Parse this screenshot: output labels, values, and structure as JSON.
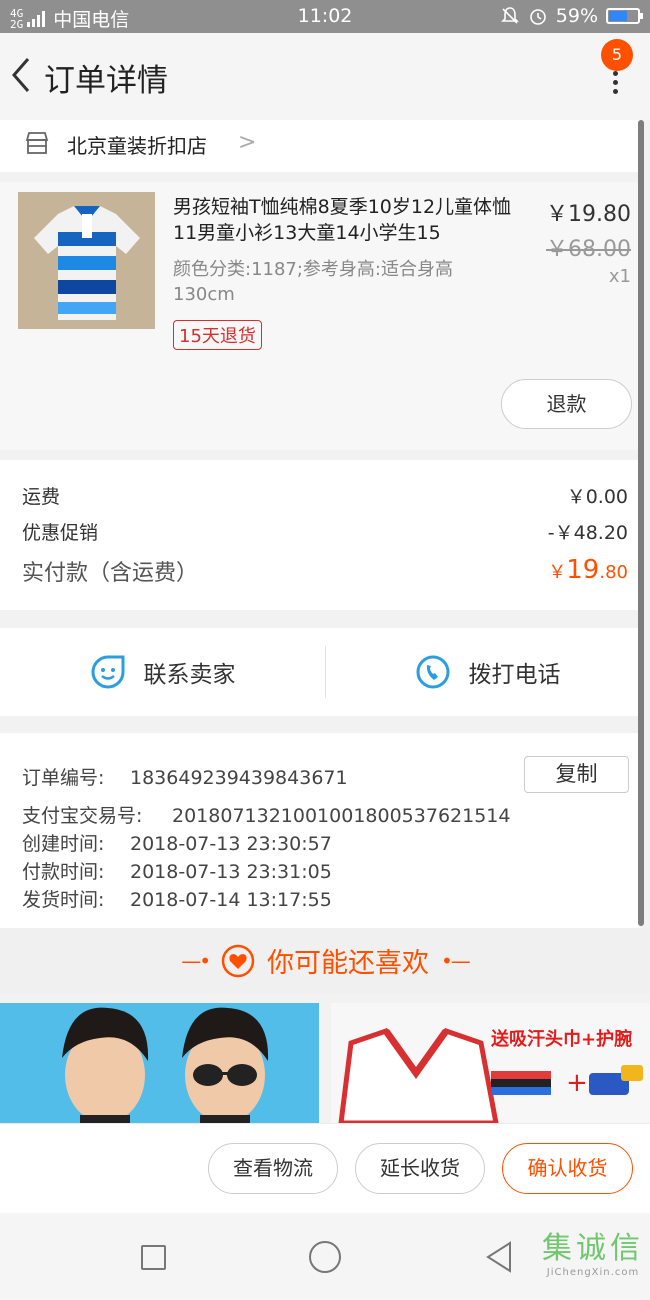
{
  "status_bar": {
    "signal": "4G\n2G",
    "carrier": "中国电信",
    "time": "11:02",
    "battery": "59%",
    "battery_level": 0.59
  },
  "header": {
    "title": "订单详情",
    "badge_count": "5"
  },
  "shop": {
    "name": "北京童装折扣店",
    "chevron": ">"
  },
  "product": {
    "title": "男孩短袖T恤纯棉8夏季10岁12儿童体恤11男童小衫13大童14小学生15",
    "spec": "颜色分类:1187;参考身高:适合身高130cm",
    "tag": "15天退货",
    "price": "￥19.80",
    "original_price": "￥68.00",
    "quantity": "x1",
    "refund_button": "退款"
  },
  "fees": {
    "shipping_label": "运费",
    "shipping_value": "￥0.00",
    "discount_label": "优惠促销",
    "discount_value": "-￥48.20",
    "total_label": "实付款（含运费）",
    "total_currency": "￥",
    "total_int": "19",
    "total_dec": ".80"
  },
  "contact": {
    "seller_label": "联系卖家",
    "phone_label": "拨打电话"
  },
  "order_info": {
    "order_no_label": "订单编号:",
    "order_no": "183649239439843671",
    "copy_button": "复制",
    "alipay_label": "支付宝交易号:",
    "alipay_no": "2018071321001001800537621514",
    "created_label": "创建时间:",
    "created": "2018-07-13 23:30:57",
    "paid_label": "付款时间:",
    "paid": "2018-07-13 23:31:05",
    "shipped_label": "发货时间:",
    "shipped": "2018-07-14 13:17:55"
  },
  "recommend": {
    "title": "你可能还喜欢",
    "promo_text": "送吸汗头巾+护腕"
  },
  "actions": {
    "logistics": "查看物流",
    "extend": "延长收货",
    "confirm": "确认收货"
  },
  "watermark": {
    "main": "集诚信",
    "sub": "JiChengXin.com"
  },
  "colors": {
    "accent": "#ff5000",
    "contact_icon": "#2a9ee0",
    "tag_red": "#d43030"
  }
}
